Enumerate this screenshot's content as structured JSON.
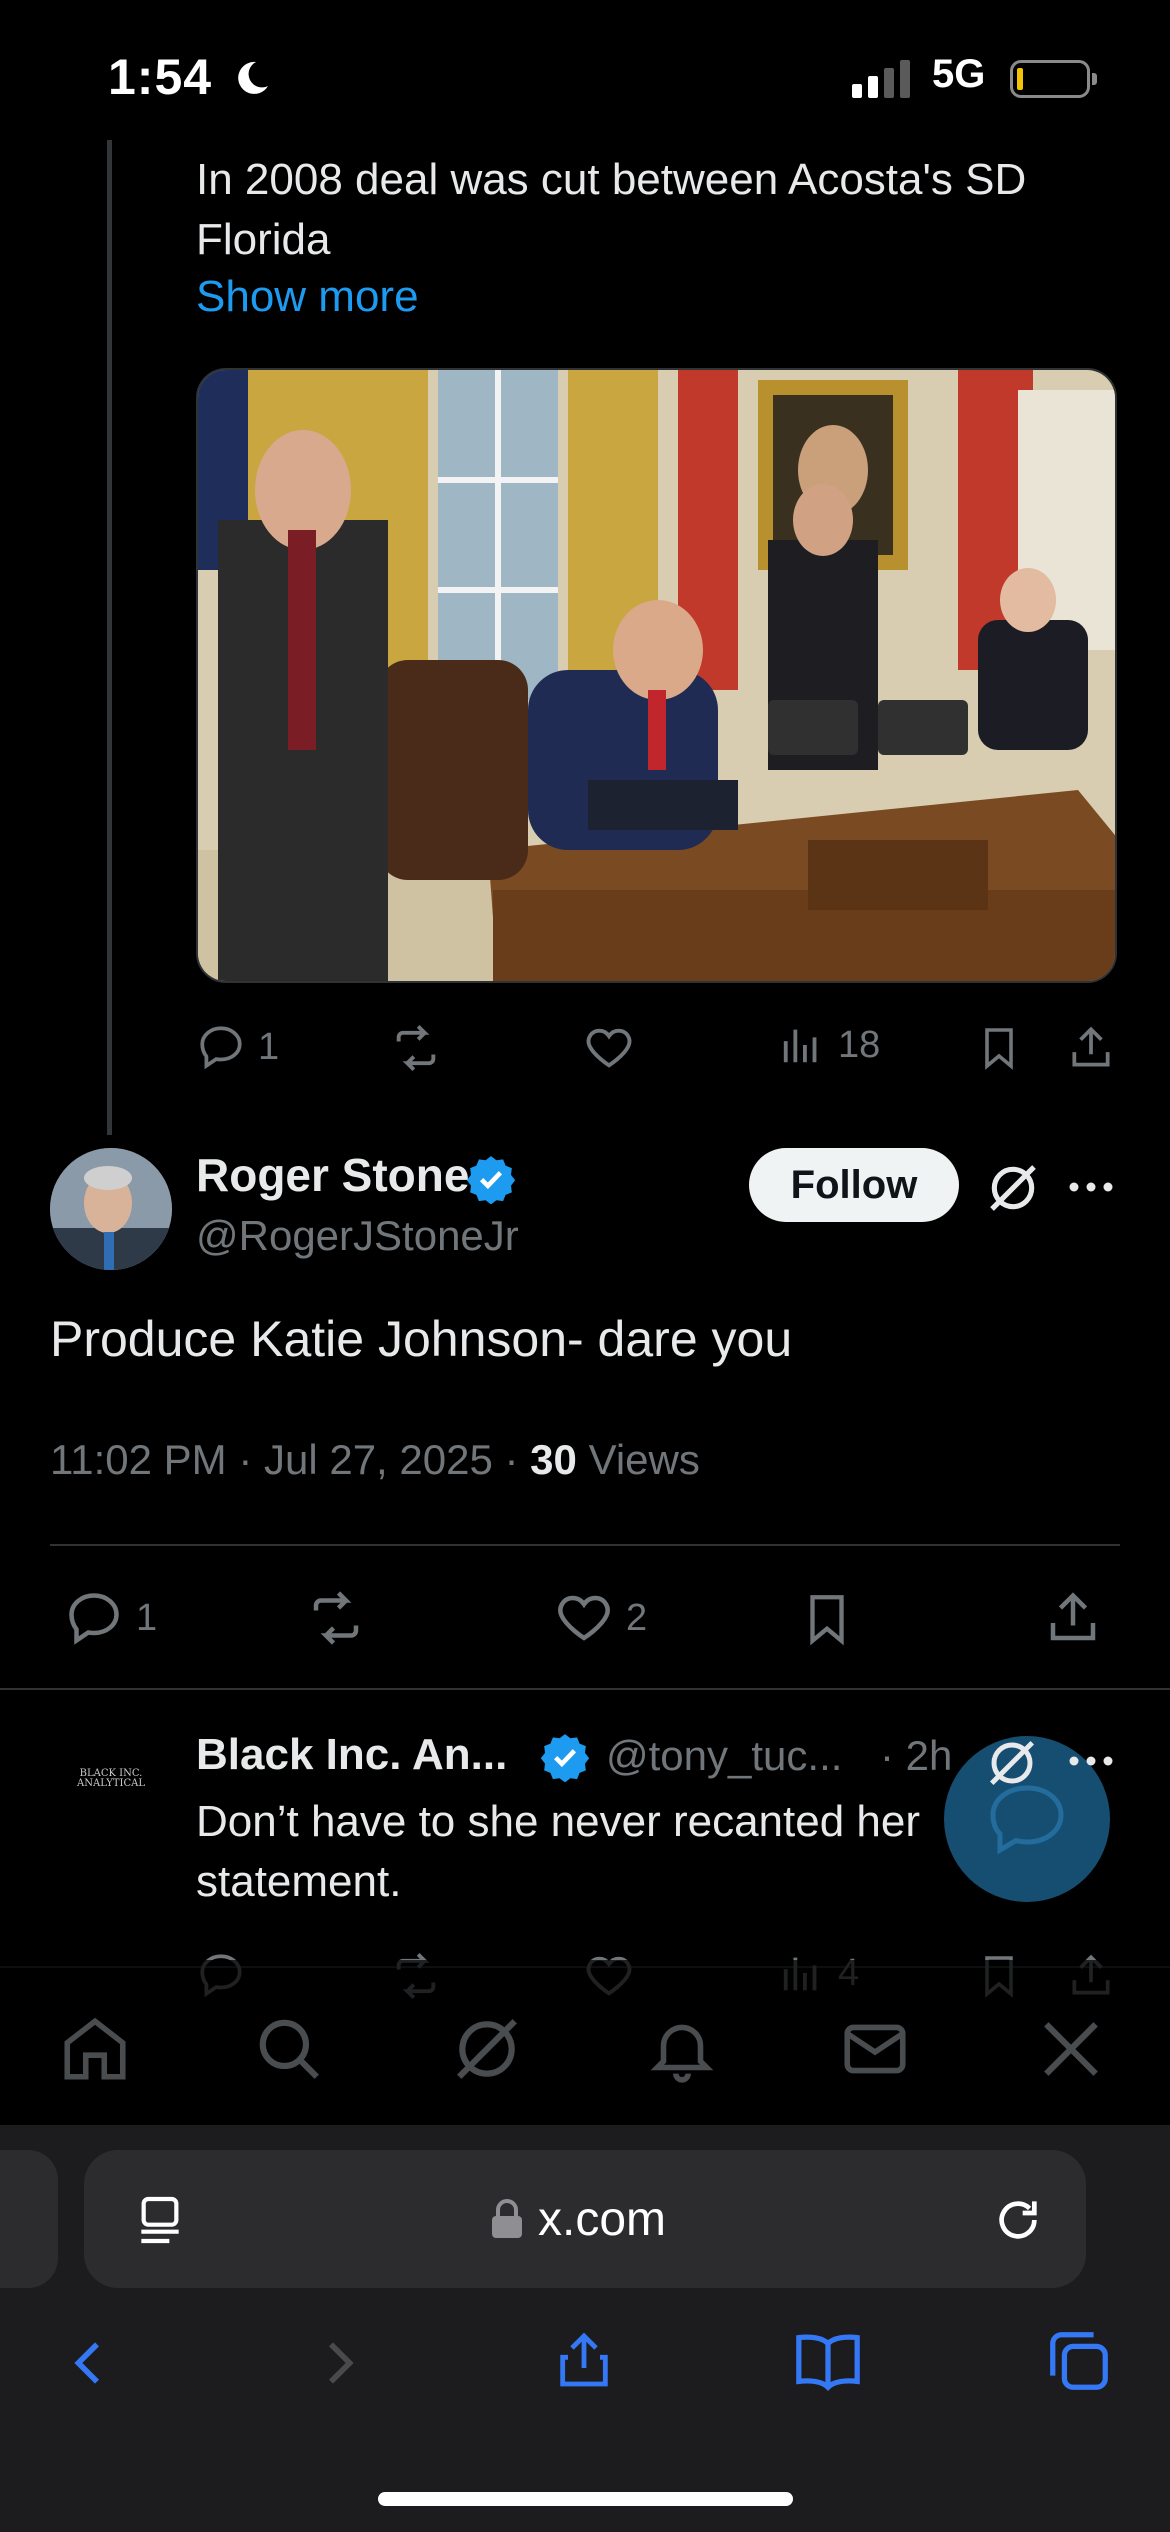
{
  "status_bar": {
    "time": "1:54",
    "network": "5G"
  },
  "parent_tweet": {
    "text_line1": "In 2008 deal was cut between Acosta's SD",
    "text_line2": "Florida",
    "show_more": "Show more",
    "reply_count": "1",
    "views_count": "18"
  },
  "main_tweet": {
    "display_name": "Roger Stone",
    "handle": "@RogerJStoneJr",
    "follow_label": "Follow",
    "text": "Produce Katie Johnson- dare you",
    "time": "11:02 PM",
    "date": "Jul 27, 2025",
    "views_number": "30",
    "views_label": "Views",
    "reply_count": "1",
    "like_count": "2"
  },
  "reply_tweet": {
    "display_name": "Black Inc. An...",
    "handle": "@tony_tuc...",
    "time": "· 2h",
    "text_line1": "Don’t have to she never recanted her",
    "text_line2": "statement.",
    "views_count": "4",
    "avatar_text": "BLACK INC. ANALYTICAL"
  },
  "browser": {
    "url": "x.com"
  },
  "colors": {
    "accent": "#1d9bf0",
    "background": "#000000",
    "secondary_text": "#71767b",
    "verified": "#1d9bf0"
  }
}
